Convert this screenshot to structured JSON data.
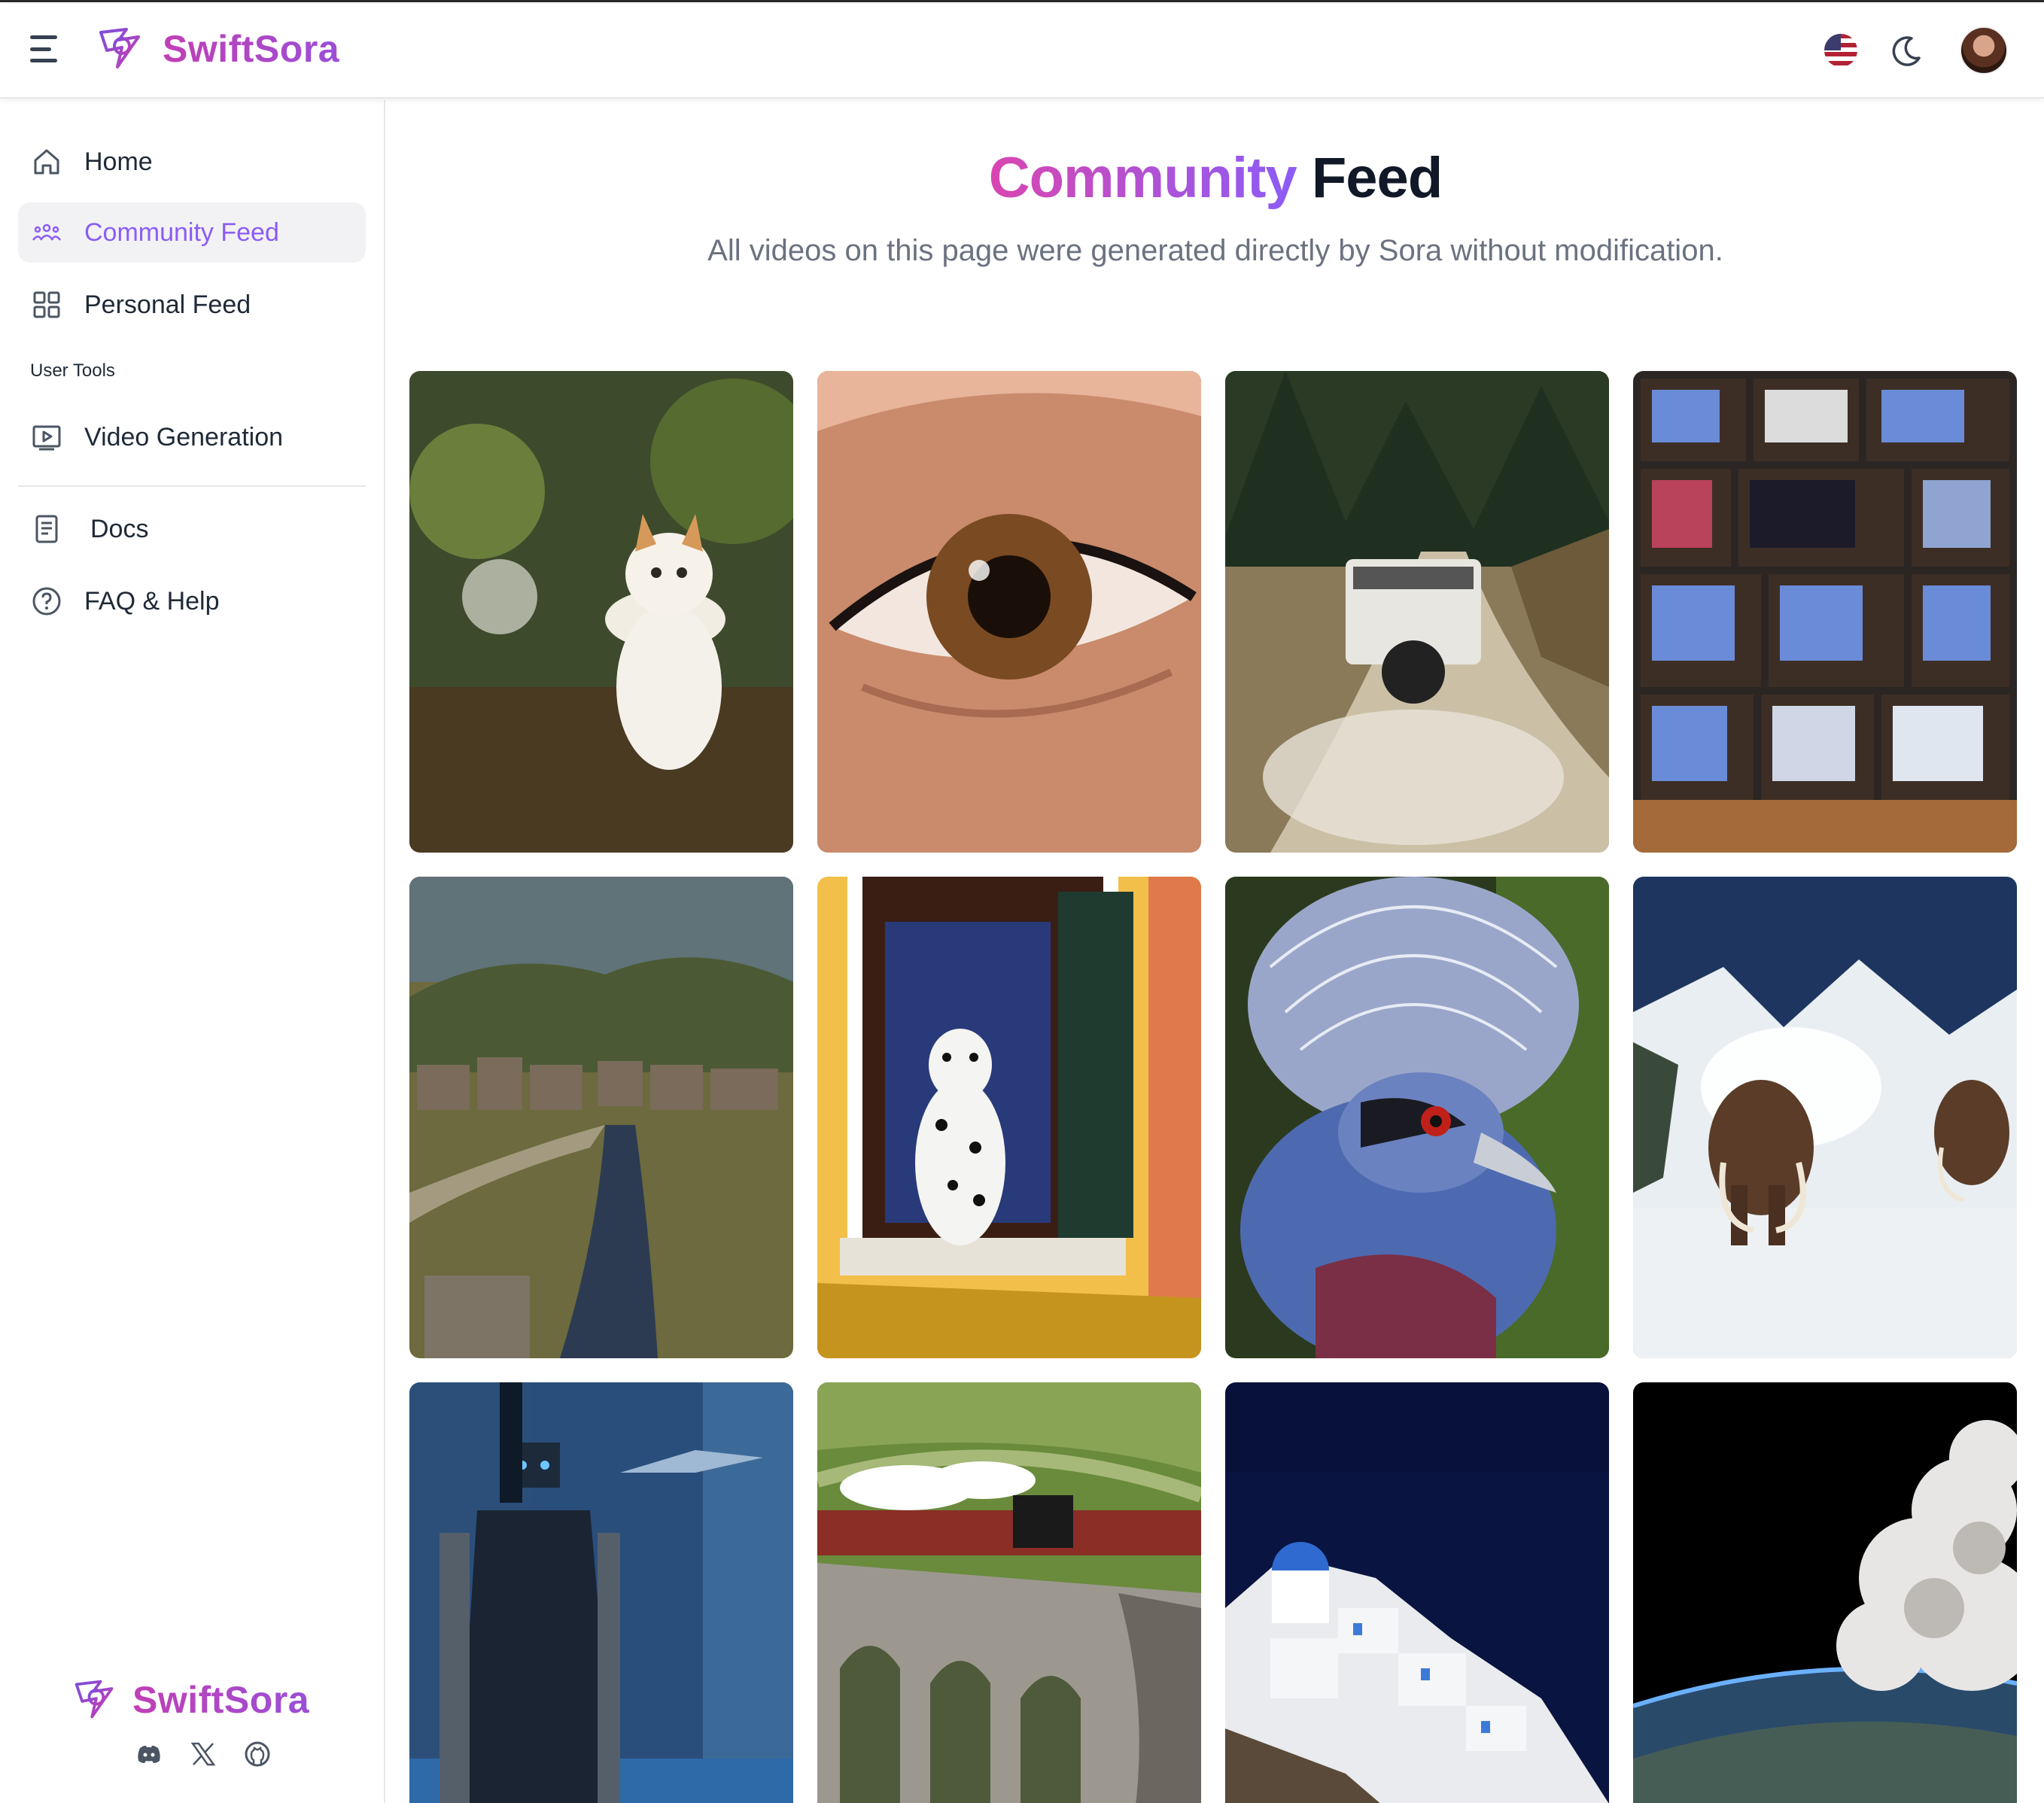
{
  "header": {
    "brand": "SwiftSora",
    "icons": {
      "menu": "menu-icon",
      "language": "us-flag-icon",
      "theme": "moon-icon",
      "profile": "avatar"
    }
  },
  "sidebar": {
    "items": [
      {
        "label": "Home",
        "icon": "home-icon"
      },
      {
        "label": "Community Feed",
        "icon": "community-icon",
        "active": true
      },
      {
        "label": "Personal Feed",
        "icon": "grid-icon"
      }
    ],
    "section_label": "User Tools",
    "tools": [
      {
        "label": "Video Generation",
        "icon": "video-icon"
      }
    ],
    "help": [
      {
        "label": "Docs",
        "icon": "document-icon"
      },
      {
        "label": "FAQ & Help",
        "icon": "question-icon"
      }
    ],
    "footer_brand": "SwiftSora",
    "socials": [
      "discord-icon",
      "x-icon",
      "github-icon"
    ]
  },
  "main": {
    "title_accent": "Community",
    "title_rest": "Feed",
    "subtitle": "All videos on this page were generated directly by Sora without modification."
  },
  "colors": {
    "accent": "#8b5cf6",
    "brand_pink": "#c13fb5",
    "active_bg": "#f2f2f4"
  }
}
